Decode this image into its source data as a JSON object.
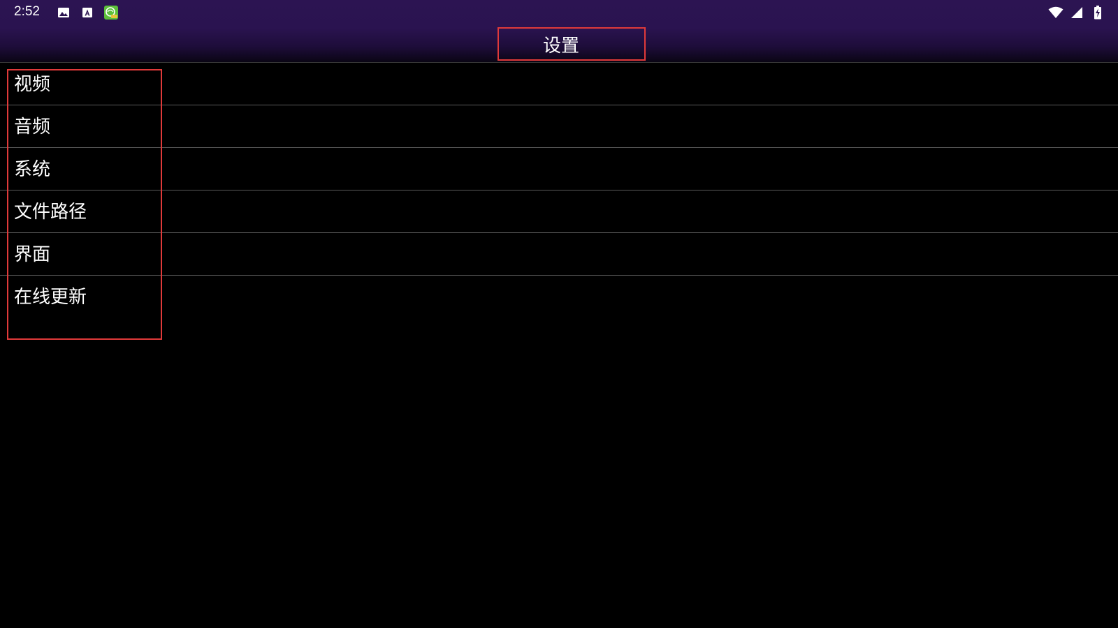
{
  "status_bar": {
    "time": "2:52",
    "left_icons": [
      "image-icon",
      "text-a-icon",
      "app-badge-icon"
    ],
    "right_icons": [
      "wifi-icon",
      "signal-icon",
      "battery-charging-icon"
    ]
  },
  "header": {
    "title": "设置"
  },
  "menu": {
    "items": [
      {
        "label": "视频"
      },
      {
        "label": "音频"
      },
      {
        "label": "系统"
      },
      {
        "label": "文件路径"
      },
      {
        "label": "界面"
      },
      {
        "label": "在线更新"
      }
    ]
  },
  "colors": {
    "header_bg": "#2a1350",
    "background": "#000000",
    "highlight_border": "#e03a3a",
    "divider": "#5a5a5a",
    "text": "#ffffff"
  }
}
